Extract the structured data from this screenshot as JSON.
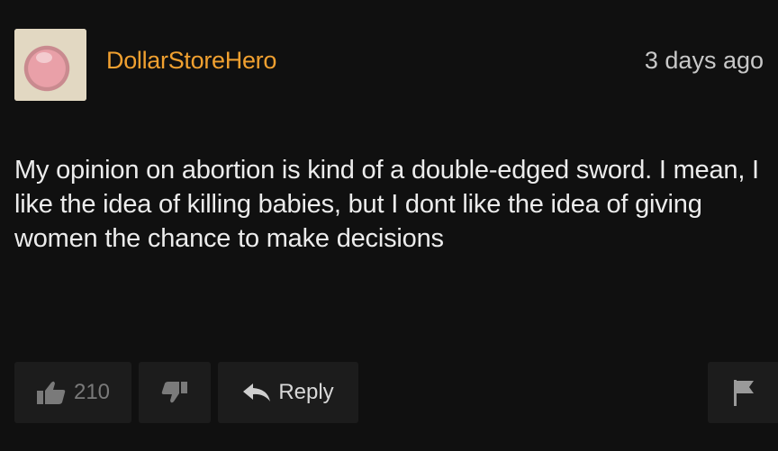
{
  "comment": {
    "username": "DollarStoreHero",
    "timestamp": "3 days ago",
    "body": "My opinion on abortion is kind of a double-edged sword. I mean, I like the idea of killing babies, but I dont like the idea of giving women the chance to make decisions",
    "like_count": "210",
    "reply_label": "Reply"
  },
  "icons": {
    "thumbs_up": "thumbs-up-icon",
    "thumbs_down": "thumbs-down-icon",
    "reply": "reply-arrow-icon",
    "flag": "flag-icon"
  },
  "colors": {
    "background": "#101010",
    "username": "#f0a030",
    "button_bg": "#1c1c1c"
  }
}
